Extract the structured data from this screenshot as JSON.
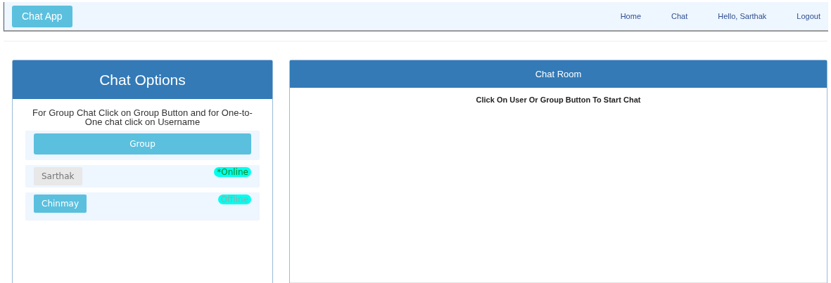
{
  "navbar": {
    "brand": "Chat App",
    "links": [
      "Home",
      "Chat",
      "Hello, Sarthak",
      "Logout"
    ]
  },
  "options_panel": {
    "title": "Chat Options",
    "instructions": "For Group Chat Click on Group Button and for One-to-One chat click on Username",
    "group_button": "Group",
    "users": [
      {
        "name": "Sarthak",
        "status": "*Online",
        "online": true,
        "disabled": true
      },
      {
        "name": "Chinmay",
        "status": "Offline",
        "online": false,
        "disabled": false
      }
    ]
  },
  "chat_room": {
    "title": "Chat Room",
    "message": "Click On User Or Group Button To Start Chat"
  }
}
